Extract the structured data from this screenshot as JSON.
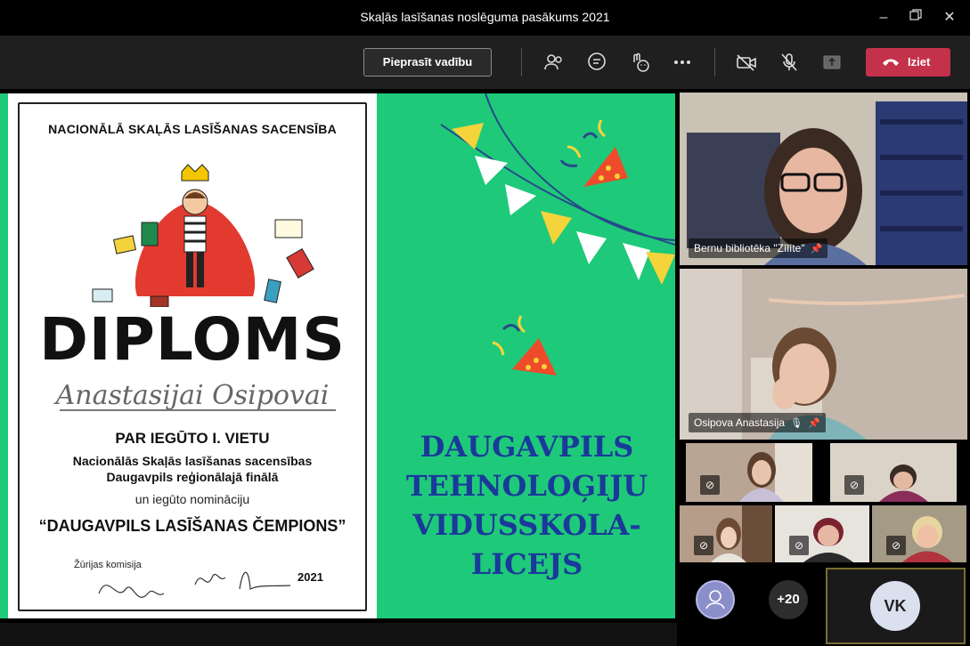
{
  "window": {
    "title": "Skaļās lasīšanas noslēguma pasākums 2021"
  },
  "toolbar": {
    "request_control_label": "Pieprasīt vadību",
    "leave_label": "Iziet",
    "leave_color": "#c4314b"
  },
  "slide": {
    "background": "#1fc97a",
    "diploma": {
      "competition": "NACIONĀLĀ SKAĻĀS LASĪŠANAS SACENSĪBA",
      "heading": "DIPLOMS",
      "recipient": "Anastasijai Osipovai",
      "award": "PAR IEGŪTO I. VIETU",
      "line1": "Nacionālās Skaļās lasīšanas sacensības",
      "line2": "Daugavpils reģionālajā finālā",
      "line3": "un iegūto nomināciju",
      "nomination": "“DAUGAVPILS LASĪŠANAS ČEMPIONS”",
      "jury": "Žūrijas komisija",
      "year": "2021"
    },
    "school": [
      "DAUGAVPILS",
      "TEHNOLOĢIJU",
      "VIDUSSKOLA-",
      "LICEJS"
    ],
    "school_color": "#1a3a9a"
  },
  "participants": {
    "pinned1": {
      "name": "Bernu bibliotēka \"Zīlīte\"",
      "icon": "pin-icon"
    },
    "pinned2": {
      "name": "Osipova Anastasija",
      "icons": [
        "mic-off-icon",
        "pin-icon"
      ]
    },
    "overflow_count": "+20",
    "self_initials": "VK"
  }
}
